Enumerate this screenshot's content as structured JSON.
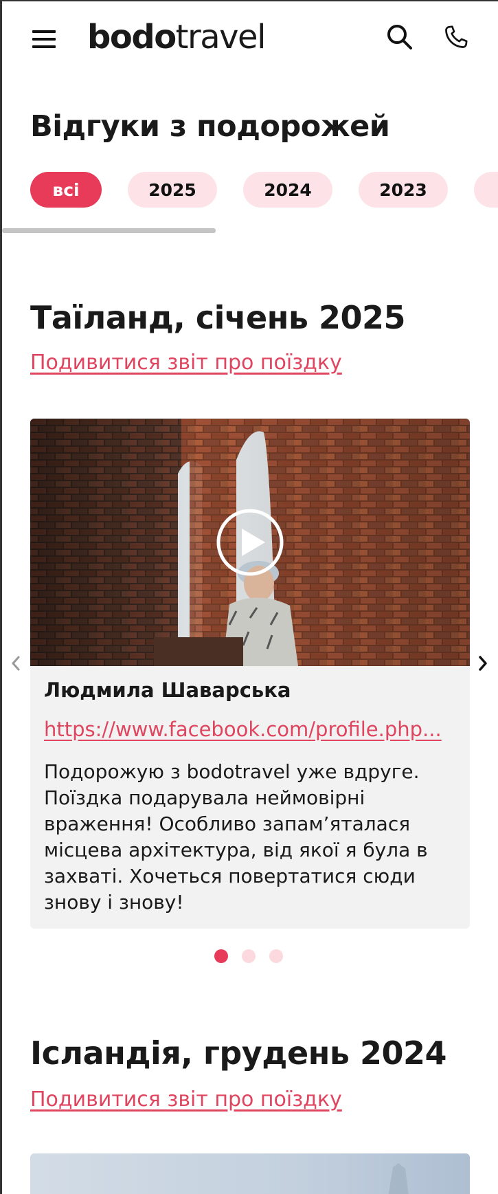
{
  "header": {
    "logo_bold": "bodo",
    "logo_light": "travel",
    "icons": {
      "menu": "hamburger-icon",
      "search": "search-icon",
      "phone": "phone-icon"
    }
  },
  "page": {
    "title": "Відгуки з подорожей"
  },
  "filters": {
    "items": [
      {
        "label": "всі",
        "active": true
      },
      {
        "label": "2025",
        "active": false
      },
      {
        "label": "2024",
        "active": false
      },
      {
        "label": "2023",
        "active": false
      },
      {
        "label": "",
        "active": false
      }
    ]
  },
  "trips": [
    {
      "title": "Таїланд, січень 2025",
      "link": "Подивитися звіт про поїздку",
      "review": {
        "name": "Людмила Шаварська",
        "profile_link": "https://www.facebook.com/profile.php...",
        "text": "Подорожую з bodotravel уже вдруге. Поїздка подарувала неймовірні враження! Особливо запам’яталася місцева архітектура, від якої я була в захваті. Хочеться повертатися сюди знову і знову!"
      },
      "pagination": {
        "total": 3,
        "current": 1
      }
    },
    {
      "title": "Ісландія, грудень 2024",
      "link": "Подивитися звіт про поїздку"
    }
  ],
  "colors": {
    "accent": "#e83b5a",
    "accent_light": "#fde3e7",
    "link": "#e0455f",
    "card_bg": "#f2f2f2"
  }
}
